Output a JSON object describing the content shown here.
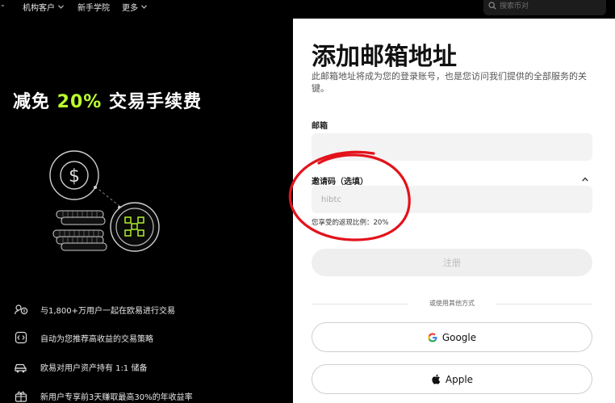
{
  "nav": {
    "items": [
      {
        "label": "机构客户"
      },
      {
        "label": "新手学院"
      },
      {
        "label": "更多"
      }
    ],
    "search_placeholder": "搜索币对"
  },
  "promo": {
    "title_prefix": "减免 ",
    "title_accent": "20%",
    "title_suffix": " 交易手续费",
    "accent_color": "#bcff2f",
    "features": [
      {
        "icon": "users-exchange-icon",
        "text": "与1,800+万用户一起在欧易进行交易"
      },
      {
        "icon": "strategy-icon",
        "text": "自动为您推荐高收益的交易策略"
      },
      {
        "icon": "reserve-car-icon",
        "text": "欧易对用户资产持有 1:1 储备"
      },
      {
        "icon": "gift-icon",
        "text": "新用户专享前3天赚取最高30%的年收益率"
      }
    ]
  },
  "form": {
    "title": "添加邮箱地址",
    "description": "此邮箱地址将成为您的登录账号，也是您访问我们提供的全部服务的关键。",
    "email_label": "邮箱",
    "email_value": "",
    "invite_label": "邀请码（选填）",
    "invite_value": "hibtc",
    "rebate_text": "您享受的返现比例：20%",
    "register_label": "注册",
    "divider_text": "或使用其他方式",
    "google_label": "Google",
    "apple_label": "Apple"
  },
  "colors": {
    "annotation": "#e3121b",
    "background": "#000000",
    "panel": "#ffffff"
  }
}
